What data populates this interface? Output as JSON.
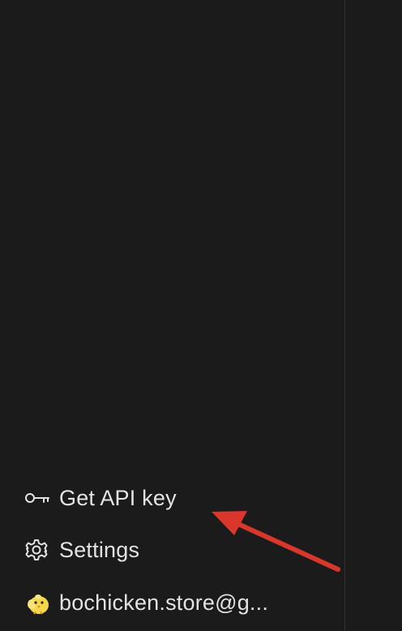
{
  "sidebar": {
    "items": [
      {
        "label": "Get API key",
        "icon": "key-icon"
      },
      {
        "label": "Settings",
        "icon": "gear-icon"
      },
      {
        "label": "bochicken.store@g...",
        "icon": "avatar"
      }
    ]
  },
  "annotation": {
    "arrow_color": "#d9372b",
    "points_to": "Get API key"
  },
  "colors": {
    "background": "#1b1b1c",
    "text": "#e3e3e3",
    "divider": "#333335"
  }
}
